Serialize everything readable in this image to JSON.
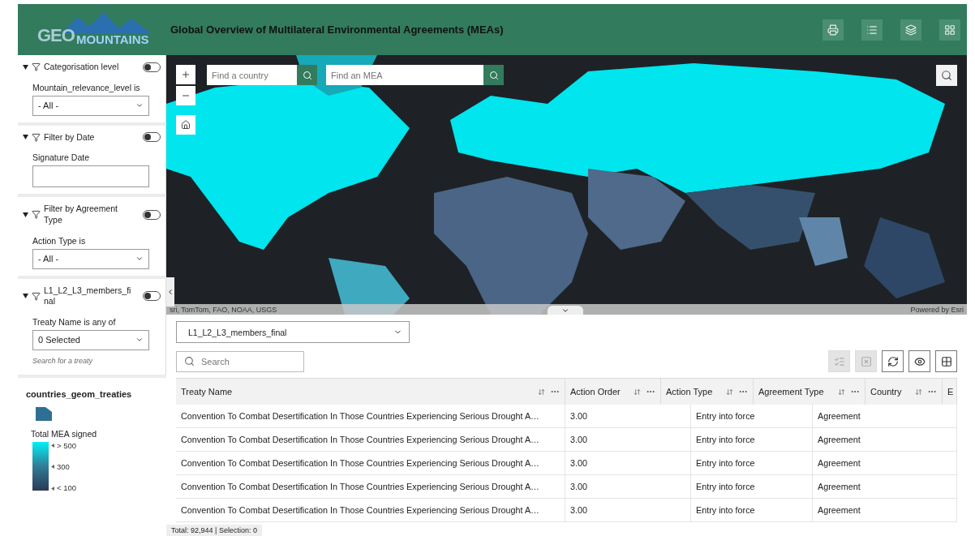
{
  "header": {
    "logo": {
      "part_1": "GEO",
      "part_2": "MOUNTAINS"
    },
    "title": "Global Overview of Multilateral Environmental Agreements (MEAs)"
  },
  "filters": [
    {
      "title": "Categorisation level",
      "on": false,
      "kind": "select",
      "field_label": "Mountain_relevance_level is",
      "value": "- All -"
    },
    {
      "title": "Filter by Date",
      "on": false,
      "kind": "input",
      "field_label": "Signature Date"
    },
    {
      "title": "Filter by Agreement Type",
      "on": false,
      "kind": "select",
      "field_label": "Action Type is",
      "value": "- All -"
    },
    {
      "title": "L1_L2_L3_members_final",
      "on": false,
      "kind": "select",
      "field_label": "Treaty Name is any of",
      "value": "0 Selected",
      "hint": "Search for a treaty"
    }
  ],
  "legend": {
    "layer": "countries_geom_treaties",
    "field": "Total MEA signed",
    "stops": [
      "> 500",
      "300",
      "< 100"
    ]
  },
  "map": {
    "search_fields": [
      {
        "placeholder": "Find a country"
      },
      {
        "placeholder": "Find an MEA"
      }
    ],
    "attribution": "sri, TomTom, FAO, NOAA, USGS",
    "powered_by": "Powered by Esri"
  },
  "table": {
    "layer_select": "L1_L2_L3_members_final",
    "search_placeholder": "Search",
    "tools": [
      {
        "kind": "select-all",
        "disabled": true
      },
      {
        "kind": "clear-selection",
        "disabled": true
      },
      {
        "kind": "refresh",
        "disabled": false
      },
      {
        "kind": "show-hide",
        "disabled": false
      },
      {
        "kind": "columns",
        "disabled": false
      }
    ],
    "columns": [
      "Treaty Name",
      "Action Order",
      "Action Type",
      "Agreement Type",
      "Country",
      "E"
    ],
    "rows": [
      [
        "Convention To Combat Desertification In Those Countries Experiencing Serious Drought A…",
        "3.00",
        "Entry into force",
        "Agreement"
      ],
      [
        "Convention To Combat Desertification In Those Countries Experiencing Serious Drought A…",
        "3.00",
        "Entry into force",
        "Agreement"
      ],
      [
        "Convention To Combat Desertification In Those Countries Experiencing Serious Drought A…",
        "3.00",
        "Entry into force",
        "Agreement"
      ],
      [
        "Convention To Combat Desertification In Those Countries Experiencing Serious Drought A…",
        "3.00",
        "Entry into force",
        "Agreement"
      ],
      [
        "Convention To Combat Desertification In Those Countries Experiencing Serious Drought A…",
        "3.00",
        "Entry into force",
        "Agreement"
      ]
    ],
    "status": "Total: 92,944 | Selection: 0"
  }
}
